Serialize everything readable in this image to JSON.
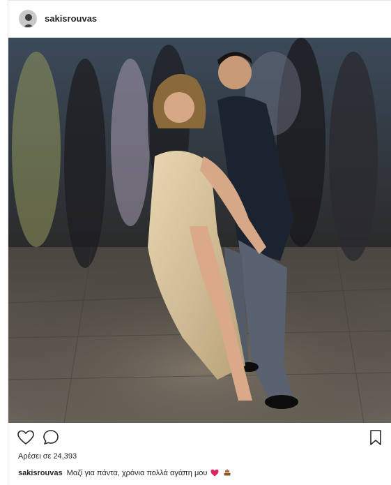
{
  "post": {
    "username": "sakisrouvas",
    "likes_text": "Αρέσει σε 24,393",
    "caption_user": "sakisrouvas",
    "caption_text": "Μαζί για πάντα, χρόνια πολλά αγάπη μου",
    "caption_emojis": [
      "red-heart",
      "cake"
    ],
    "photo_description_icons": [
      "avatar",
      "photo"
    ]
  },
  "actions": {
    "like_icon": "heart-outline-icon",
    "comment_icon": "speech-bubble-icon",
    "save_icon": "bookmark-icon"
  },
  "colors": {
    "text": "#262626",
    "border": "#e6e6e6",
    "heart": "#e0245e"
  }
}
